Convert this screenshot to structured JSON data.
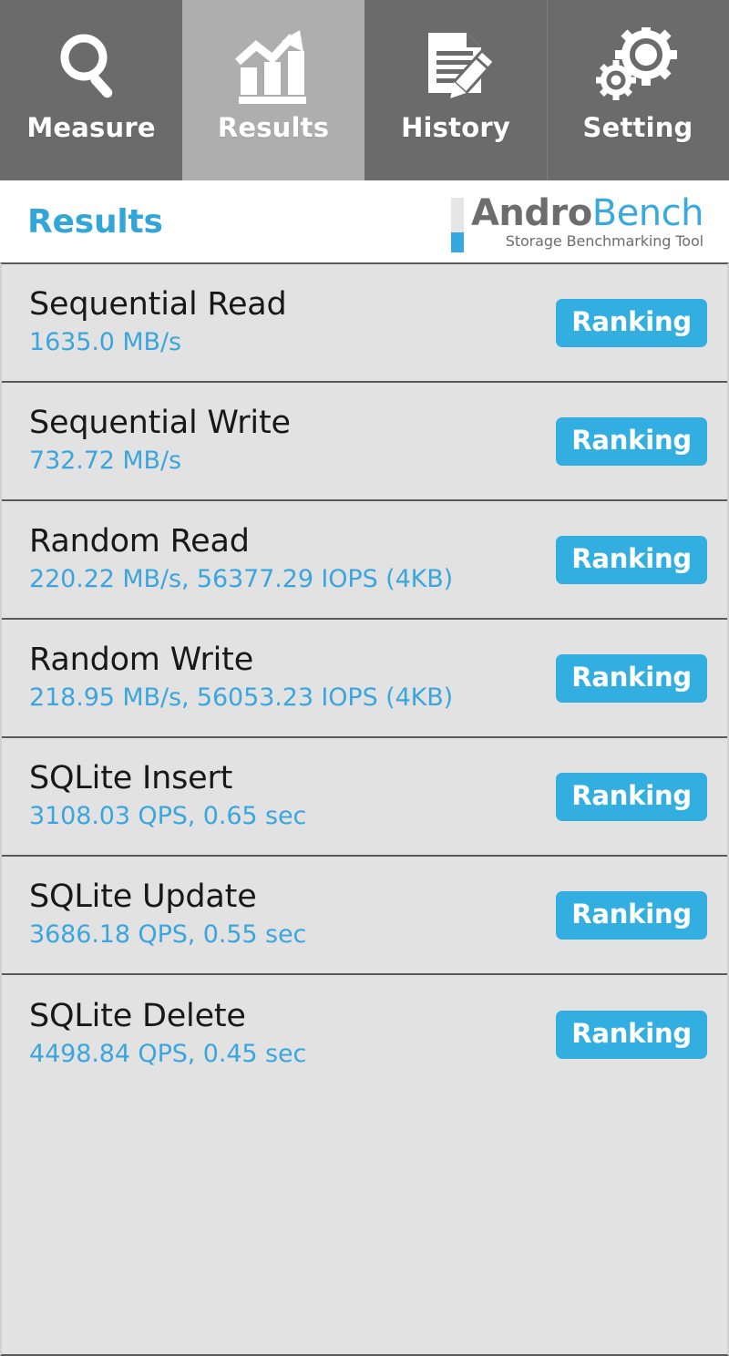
{
  "tabs": [
    {
      "label": "Measure",
      "icon": "magnifier-icon",
      "active": false
    },
    {
      "label": "Results",
      "icon": "bar-chart-arrow-icon",
      "active": true
    },
    {
      "label": "History",
      "icon": "document-pencil-icon",
      "active": false
    },
    {
      "label": "Setting",
      "icon": "gears-icon",
      "active": false
    }
  ],
  "header": {
    "title": "Results",
    "brand_name_part1": "Andro",
    "brand_name_part2": "Bench",
    "brand_subtitle": "Storage Benchmarking Tool"
  },
  "results": [
    {
      "name": "Sequential Read",
      "value": "1635.0 MB/s",
      "button": "Ranking"
    },
    {
      "name": "Sequential Write",
      "value": "732.72 MB/s",
      "button": "Ranking"
    },
    {
      "name": "Random Read",
      "value": "220.22 MB/s, 56377.29 IOPS (4KB)",
      "button": "Ranking"
    },
    {
      "name": "Random Write",
      "value": "218.95 MB/s, 56053.23 IOPS (4KB)",
      "button": "Ranking"
    },
    {
      "name": "SQLite Insert",
      "value": "3108.03 QPS, 0.65 sec",
      "button": "Ranking"
    },
    {
      "name": "SQLite Update",
      "value": "3686.18 QPS, 0.55 sec",
      "button": "Ranking"
    },
    {
      "name": "SQLite Delete",
      "value": "4498.84 QPS, 0.45 sec",
      "button": "Ranking"
    }
  ],
  "colors": {
    "accent_blue": "#33aee0",
    "title_blue": "#32a6d8",
    "value_blue": "#3ba6de",
    "tab_inactive": "#6b6b6b",
    "tab_active": "#aeaeae",
    "row_bg": "#e2e2e2",
    "divider": "#585858"
  }
}
